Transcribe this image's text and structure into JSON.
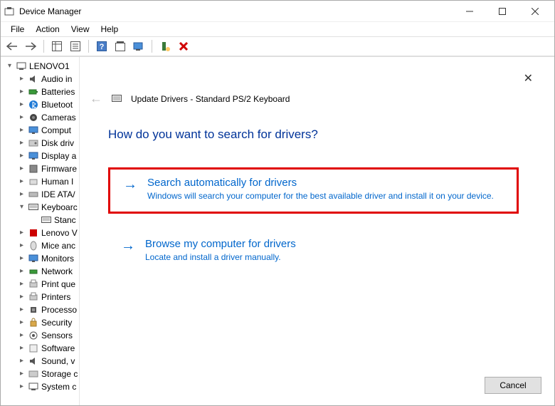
{
  "window": {
    "title": "Device Manager",
    "menus": [
      "File",
      "Action",
      "View",
      "Help"
    ]
  },
  "tree": {
    "root": "LENOVO1",
    "nodes": [
      {
        "label": "Audio in",
        "expander": ">"
      },
      {
        "label": "Batteries",
        "expander": ">"
      },
      {
        "label": "Bluetoot",
        "expander": ">"
      },
      {
        "label": "Cameras",
        "expander": ">"
      },
      {
        "label": "Comput",
        "expander": ">"
      },
      {
        "label": "Disk driv",
        "expander": ">"
      },
      {
        "label": "Display a",
        "expander": ">"
      },
      {
        "label": "Firmware",
        "expander": ">"
      },
      {
        "label": "Human I",
        "expander": ">"
      },
      {
        "label": "IDE ATA/",
        "expander": ">"
      },
      {
        "label": "Keyboarc",
        "expander": "v",
        "children": [
          {
            "label": "Stanc"
          }
        ]
      },
      {
        "label": "Lenovo V",
        "expander": ">"
      },
      {
        "label": "Mice anc",
        "expander": ">"
      },
      {
        "label": "Monitors",
        "expander": ">"
      },
      {
        "label": "Network",
        "expander": ">"
      },
      {
        "label": "Print que",
        "expander": ">"
      },
      {
        "label": "Printers",
        "expander": ">"
      },
      {
        "label": "Processo",
        "expander": ">"
      },
      {
        "label": "Security",
        "expander": ">"
      },
      {
        "label": "Sensors",
        "expander": ">"
      },
      {
        "label": "Software",
        "expander": ">"
      },
      {
        "label": "Sound, v",
        "expander": ">"
      },
      {
        "label": "Storage c",
        "expander": ">"
      },
      {
        "label": "System c",
        "expander": ">"
      }
    ]
  },
  "dialog": {
    "title": "Update Drivers - Standard PS/2 Keyboard",
    "question": "How do you want to search for drivers?",
    "options": [
      {
        "title": "Search automatically for drivers",
        "desc": "Windows will search your computer for the best available driver and install it on your device.",
        "highlight": true
      },
      {
        "title": "Browse my computer for drivers",
        "desc": "Locate and install a driver manually.",
        "highlight": false
      }
    ],
    "cancel": "Cancel"
  }
}
